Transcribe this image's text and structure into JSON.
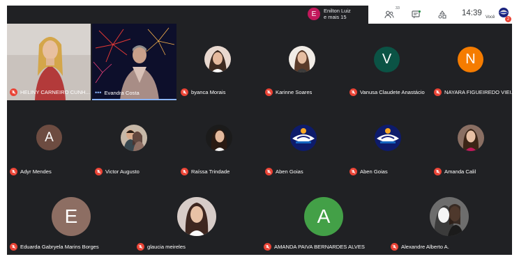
{
  "presenting": {
    "initial": "E",
    "line1": "Enilton Luiz",
    "line2": "e mais 15"
  },
  "toolbar": {
    "people_count": "33",
    "time": "14:39",
    "self_label": "Você",
    "self_badge": "2"
  },
  "colors": {
    "background": "#202124",
    "mute_red": "#ea4335",
    "avatar_green_dark": "#0b5345",
    "avatar_orange": "#f57c00",
    "avatar_brown": "#6d4c41",
    "avatar_taupe": "#8d6e63",
    "avatar_green": "#43a047"
  },
  "participants": [
    {
      "name": "HELINY CARNEIRO CUNH...",
      "kind": "video"
    },
    {
      "name": "Evandra Costa",
      "kind": "video"
    },
    {
      "name": "byanca Morais",
      "kind": "photo"
    },
    {
      "name": "Karinne Soares",
      "kind": "photo"
    },
    {
      "name": "Vanusa Claudete Anastácio",
      "kind": "letter",
      "initial": "V"
    },
    {
      "name": "NAYARA FIGUEIREDO VIEI...",
      "kind": "letter",
      "initial": "N"
    },
    {
      "name": "Adyr Mendes",
      "kind": "letter",
      "initial": "A"
    },
    {
      "name": "Victor Augusto",
      "kind": "photo"
    },
    {
      "name": "Raíssa Trindade",
      "kind": "photo"
    },
    {
      "name": "Aben Goias",
      "kind": "logo"
    },
    {
      "name": "Aben Goias",
      "kind": "logo"
    },
    {
      "name": "Amanda Calil",
      "kind": "photo"
    },
    {
      "name": "Eduarda Gabryela Marins Borges",
      "kind": "letter",
      "initial": "E"
    },
    {
      "name": "glaucia meireles",
      "kind": "photo"
    },
    {
      "name": "AMANDA PAIVA BERNARDES ALVES",
      "kind": "letter",
      "initial": "A"
    },
    {
      "name": "Alexandre Alberto A.",
      "kind": "photo"
    }
  ]
}
